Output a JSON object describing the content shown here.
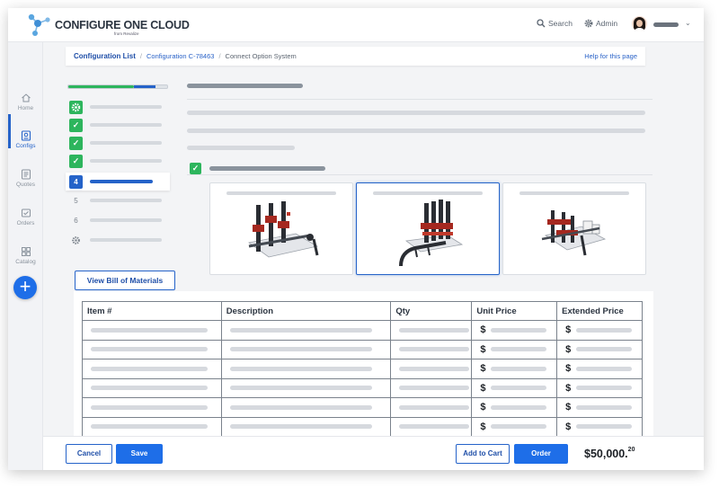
{
  "header": {
    "brand": "CONFIGURE ONE CLOUD",
    "brand_sub": "from Revalize",
    "search_label": "Search",
    "admin_label": "Admin"
  },
  "sidebar": {
    "items": [
      {
        "label": "Home",
        "icon": "home-icon"
      },
      {
        "label": "Configs",
        "icon": "configs-icon"
      },
      {
        "label": "Quotes",
        "icon": "quotes-icon"
      },
      {
        "label": "Orders",
        "icon": "orders-icon"
      },
      {
        "label": "Catalog",
        "icon": "catalog-icon"
      }
    ],
    "active": "Configs",
    "add_label": "+"
  },
  "breadcrumb": {
    "items": [
      "Configuration List",
      "Configuration C-78463",
      "Connect Option System"
    ],
    "separator": "/",
    "help": "Help for this page"
  },
  "steps": {
    "progress_complete": 0.66,
    "progress_current": 0.88,
    "items": [
      {
        "badge": "",
        "state": "gear"
      },
      {
        "badge": "✓",
        "state": "done"
      },
      {
        "badge": "✓",
        "state": "done"
      },
      {
        "badge": "✓",
        "state": "done"
      },
      {
        "badge": "4",
        "state": "active"
      },
      {
        "badge": "5",
        "state": "pending"
      },
      {
        "badge": "6",
        "state": "pending"
      },
      {
        "badge": "",
        "state": "gear-pending"
      }
    ]
  },
  "options": {
    "selected_index": 1,
    "check": "✓"
  },
  "bom": {
    "tab_label": "View Bill of Materials",
    "columns": [
      "Item #",
      "Description",
      "Qty",
      "Unit Price",
      "Extended Price"
    ],
    "currency_symbol": "$",
    "row_count": 6
  },
  "footer": {
    "cancel": "Cancel",
    "save": "Save",
    "add_to_cart": "Add to Cart",
    "order": "Order",
    "total_main": "$50,000.",
    "total_cents": "20"
  },
  "colors": {
    "accent": "#2563c9",
    "success": "#2db55d",
    "button": "#1e6ee8"
  }
}
